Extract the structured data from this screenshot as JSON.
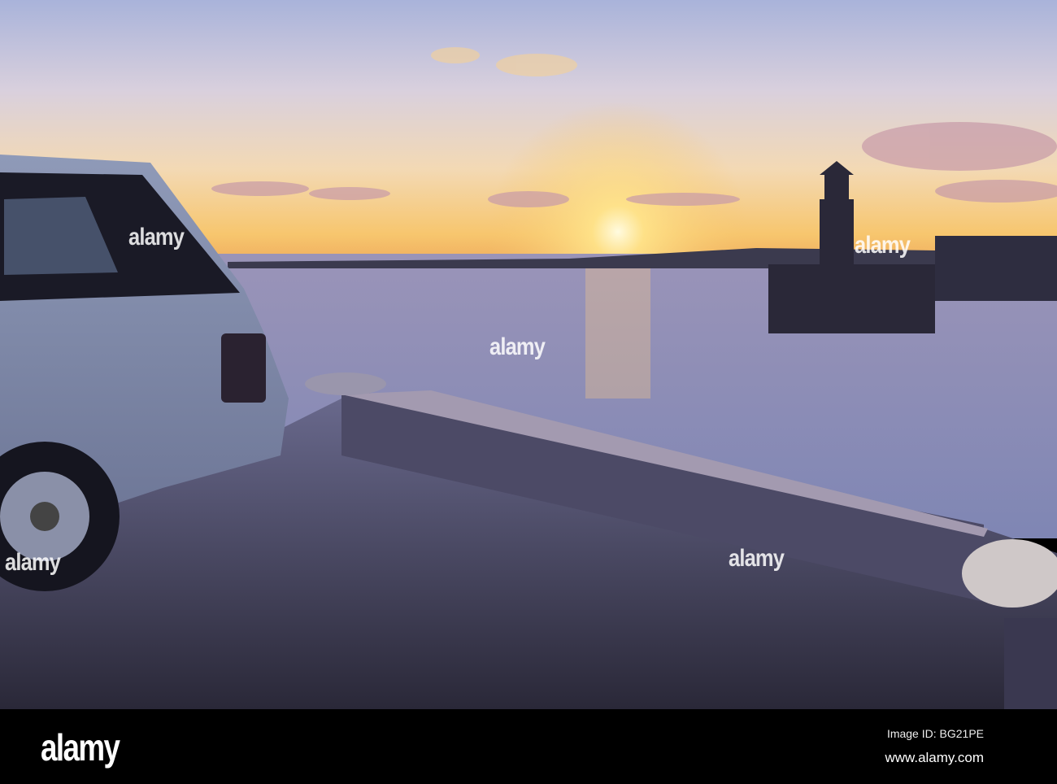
{
  "watermark": {
    "text": "alamy"
  },
  "footer": {
    "logo": "alamy",
    "image_id": "Image ID: BG21PE",
    "url": "www.alamy.com"
  }
}
